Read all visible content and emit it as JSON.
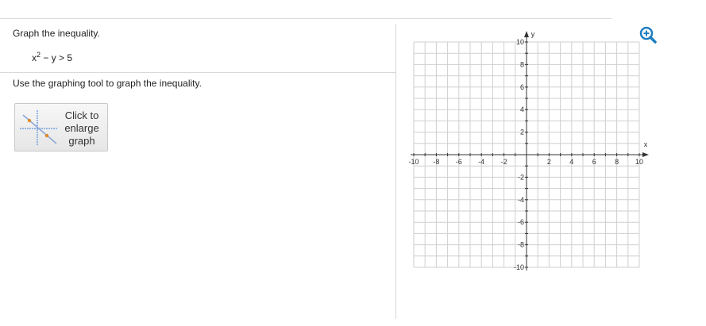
{
  "question": {
    "prompt": "Graph the inequality.",
    "expression": {
      "base": "x",
      "exponent": "2",
      "rest": " − y > 5"
    },
    "instruction": "Use the graphing tool to graph the inequality."
  },
  "enlarge_button": {
    "label_lines": [
      "Click to",
      "enlarge",
      "graph"
    ]
  },
  "zoom": {
    "icon": "zoom-in-icon",
    "color": "#1f7fc1"
  },
  "graph": {
    "x_axis_label": "x",
    "y_axis_label": "y",
    "xlim": [
      -10,
      10
    ],
    "ylim": [
      -10,
      10
    ],
    "grid": true,
    "x_tick_labels": [
      "-10",
      "-8",
      "-6",
      "-4",
      "-2",
      "2",
      "4",
      "6",
      "8",
      "10"
    ],
    "y_tick_labels": [
      "10",
      "8",
      "6",
      "4",
      "2",
      "-2",
      "-4",
      "-6",
      "-8",
      "-10"
    ],
    "grid_color": "#cfcfcf",
    "axis_color": "#333333"
  }
}
